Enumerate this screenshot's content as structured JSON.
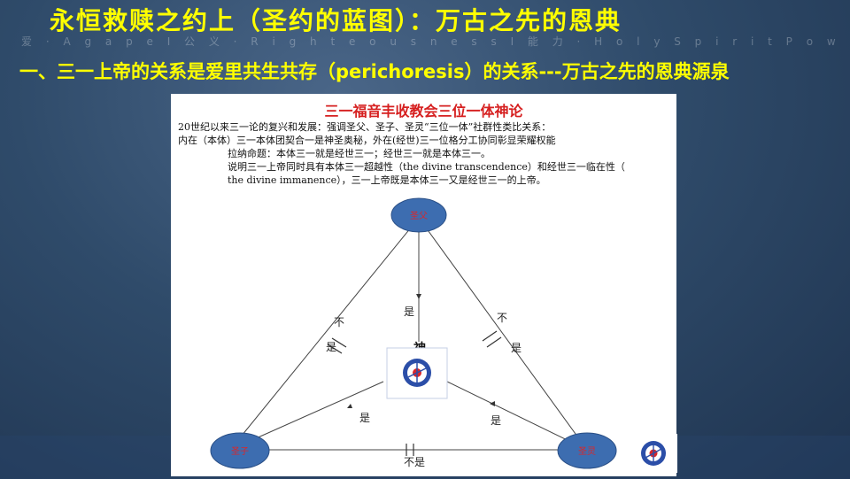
{
  "slide": {
    "title": "永恒救赎之约上（圣约的蓝图）：万古之先的恩典",
    "subtitle_band": "爱 · A g a p e   I   公 义 · R i g h t e o u s n e s s   I   能 力 · H o l y  S p i r i t  P o w e r",
    "heading": "一、三一上帝的关系是爱里共生共存（perichoresis）的关系---万古之先的恩典源泉"
  },
  "panel": {
    "title": "三一福音丰收教会三位一体神论",
    "lines": [
      "20世纪以来三一论的复兴和发展：强调圣父、圣子、圣灵“三位一体”社群性类比关系：",
      "内在（本体）三一本体团契合一是神圣奥秘，外在(经世)三一位格分工协同彰显荣耀权能",
      "拉纳命题：本体三一就是经世三一；经世三一就是本体三一。",
      "说明三一上帝同时具有本体三一超越性（the divine transcendence）和经世三一临在性（",
      "the divine immanence），三一上帝既是本体三一又是经世三一的上帝。"
    ]
  },
  "diagram": {
    "nodes": {
      "father": "圣父",
      "son": "圣子",
      "spirit": "圣灵",
      "god": "神"
    },
    "edges": {
      "is": "是",
      "not": "不",
      "is_char": "是",
      "is_not": "不是"
    },
    "colors": {
      "node_fill": "#3d6db0",
      "node_label": "#d9272b",
      "line": "#444444",
      "title": "#d62020",
      "heading": "#ffff00"
    }
  }
}
